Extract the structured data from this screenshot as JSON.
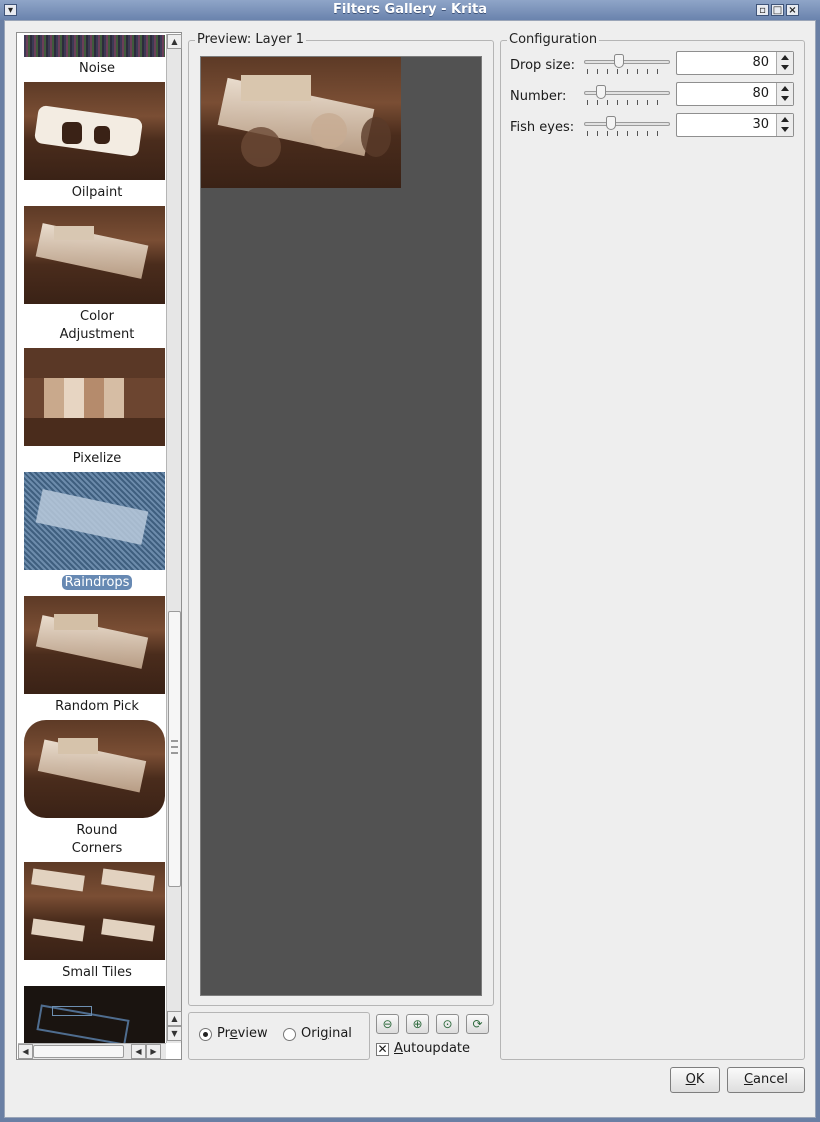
{
  "window": {
    "title": "Filters Gallery - Krita"
  },
  "filters": [
    {
      "name": "Noise"
    },
    {
      "name": "Oilpaint"
    },
    {
      "name": "Color Adjustment",
      "line1": "Color",
      "line2": "Adjustment"
    },
    {
      "name": "Pixelize"
    },
    {
      "name": "Raindrops",
      "selected": true
    },
    {
      "name": "Random Pick"
    },
    {
      "name": "Round Corners",
      "line1": "Round",
      "line2": "Corners"
    },
    {
      "name": "Small Tiles"
    }
  ],
  "preview": {
    "group_title": "Preview: Layer 1"
  },
  "config": {
    "group_title": "Configuration",
    "params": [
      {
        "label": "Drop size:",
        "value": "80"
      },
      {
        "label": "Number:",
        "value": "80"
      },
      {
        "label": "Fish eyes:",
        "value": "30"
      }
    ]
  },
  "bottom": {
    "preview_pre": "Pr",
    "preview_u": "e",
    "preview_post": "view",
    "original_pre": "Ori",
    "original_u": "g",
    "original_post": "inal",
    "autoupdate_pre": "",
    "autoupdate_u": "A",
    "autoupdate_post": "utoupdate",
    "ok_pre": "",
    "ok_u": "O",
    "ok_post": "K",
    "cancel_pre": "",
    "cancel_u": "C",
    "cancel_post": "ancel"
  },
  "icons": {
    "zoom_out": "zoom-out-icon",
    "zoom_in": "zoom-in-icon",
    "zoom_actual": "zoom-actual-size-icon",
    "refresh": "refresh-icon"
  },
  "colors": {
    "selection": "#6789b3",
    "preview_bg": "#525252"
  }
}
